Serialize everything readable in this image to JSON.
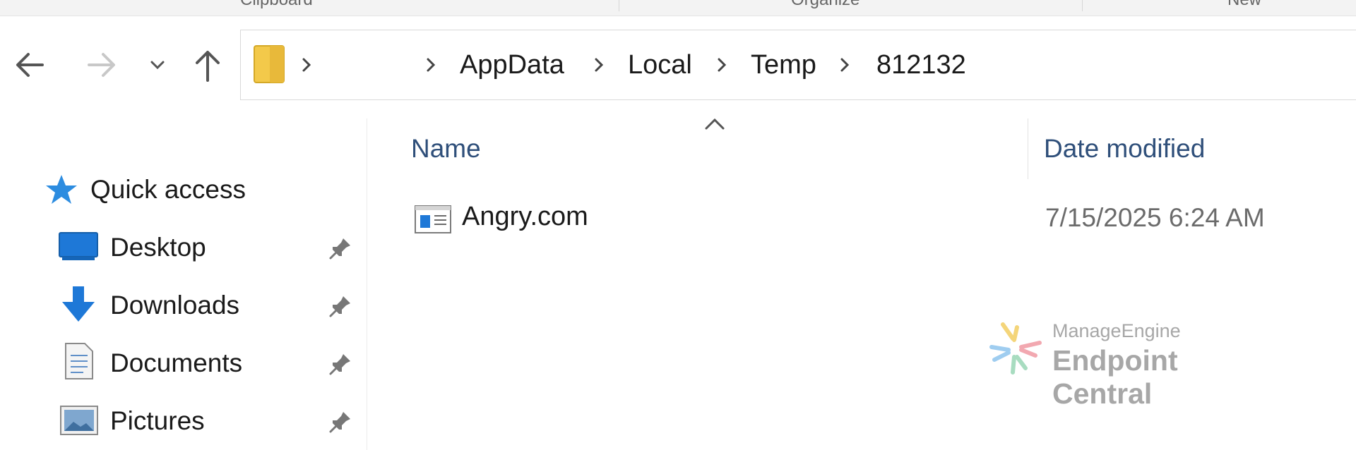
{
  "ribbon": {
    "groups": [
      "Clipboard",
      "Organize",
      "New"
    ]
  },
  "nav_buttons": {
    "back_icon": "arrow-left-icon",
    "forward_icon": "arrow-right-icon",
    "recent_icon": "chevron-down-icon",
    "up_icon": "arrow-up-icon"
  },
  "address_bar": {
    "folder_icon": "folder-icon",
    "crumbs": [
      "AppData",
      "Local",
      "Temp",
      "812132"
    ]
  },
  "nav_pane": {
    "quick_access": "Quick access",
    "items": [
      {
        "label": "Desktop",
        "icon": "desktop-icon",
        "pinned": true
      },
      {
        "label": "Downloads",
        "icon": "downloads-icon",
        "pinned": true
      },
      {
        "label": "Documents",
        "icon": "documents-icon",
        "pinned": true
      },
      {
        "label": "Pictures",
        "icon": "pictures-icon",
        "pinned": true
      }
    ]
  },
  "file_list": {
    "columns": [
      "Name",
      "Date modified"
    ],
    "rows": [
      {
        "name": "Angry.com",
        "date_modified": "7/15/2025 6:24 AM",
        "icon": "application-file-icon"
      }
    ]
  },
  "watermark": {
    "brand": "ManageEngine",
    "product": "Endpoint Central"
  },
  "colors": {
    "accent_blue": "#1e78d7",
    "header_text": "#2f4f7a",
    "folder_yellow": "#f3c94a"
  }
}
